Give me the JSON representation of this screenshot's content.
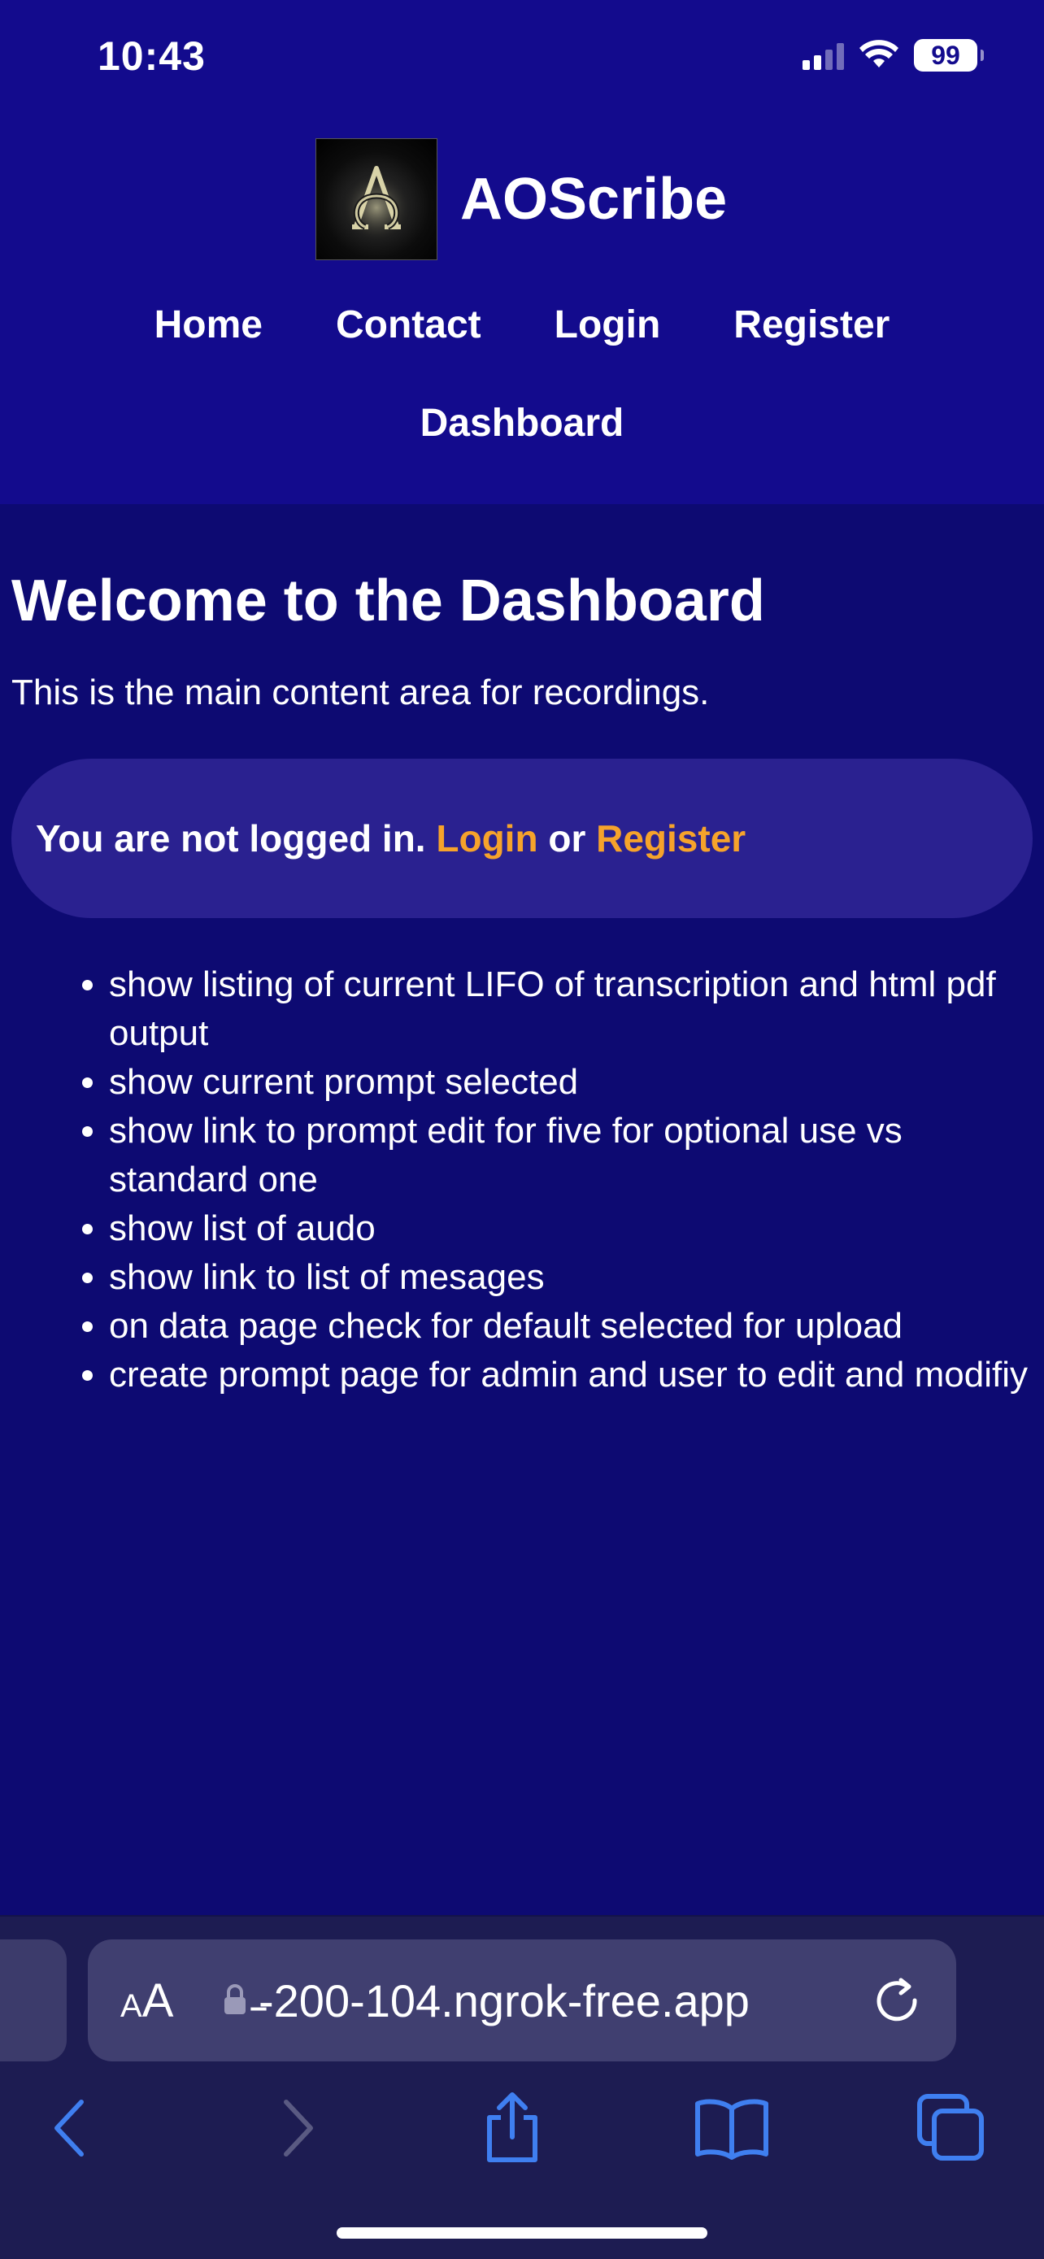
{
  "status_bar": {
    "time": "10:43",
    "battery": "99"
  },
  "header": {
    "brand": "AOScribe",
    "nav": [
      "Home",
      "Contact",
      "Login",
      "Register",
      "Dashboard"
    ]
  },
  "main": {
    "title": "Welcome to the Dashboard",
    "intro": "This is the main content area for recordings.",
    "notice": {
      "text": "You are not logged in.",
      "login_label": "Login",
      "or_text": "or",
      "register_label": "Register"
    },
    "todo": [
      "show listing of current LIFO of transcription and html pdf output",
      "show current prompt selected",
      "show link to prompt edit for five for optional use vs standard one",
      "show list of audo",
      "show link to list of mesages",
      "on data page check for default selected for upload",
      "create prompt page for admin and user to edit and modifiy"
    ]
  },
  "browser": {
    "text_size_label": "AA",
    "url": "̵-200-104.ngrok-free.app",
    "icons": [
      "lock-icon",
      "reload-icon",
      "back-icon",
      "forward-icon",
      "share-icon",
      "bookmarks-icon",
      "tabs-icon"
    ]
  },
  "colors": {
    "header_bg": "#130b8d",
    "page_bg": "#0d0a72",
    "notice_bg": "#2a2190",
    "link": "#f6a32b",
    "toolbar_accent": "#3f7ff0"
  }
}
